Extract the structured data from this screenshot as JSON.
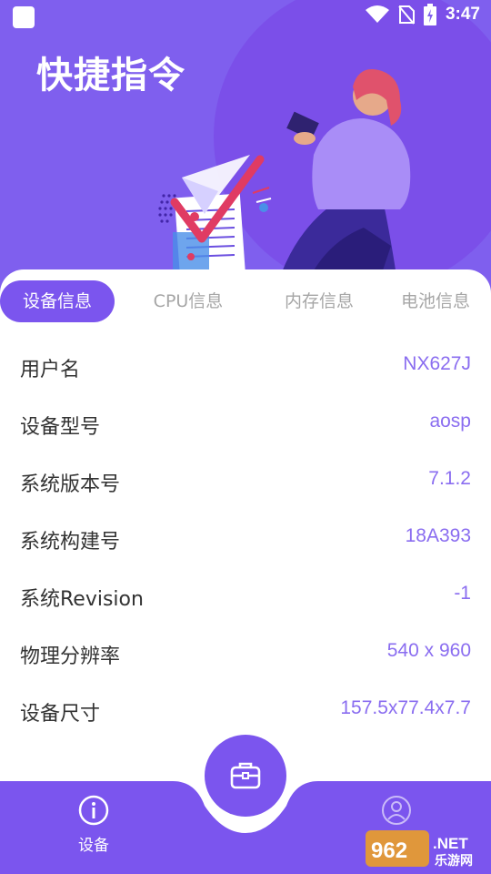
{
  "statusbar": {
    "time": "3:47",
    "icons": [
      "wifi-icon",
      "no-sim-icon",
      "battery-charging-icon"
    ]
  },
  "app": {
    "title": "快捷指令"
  },
  "tabs": [
    {
      "label": "设备信息",
      "active": true
    },
    {
      "label": "CPU信息",
      "active": false
    },
    {
      "label": "内存信息",
      "active": false
    },
    {
      "label": "电池信息",
      "active": false
    }
  ],
  "device_info": [
    {
      "label": "用户名",
      "value": "NX627J"
    },
    {
      "label": "设备型号",
      "value": "aosp"
    },
    {
      "label": "系统版本号",
      "value": "7.1.2"
    },
    {
      "label": "系统构建号",
      "value": "18A393"
    },
    {
      "label": "系统Revision",
      "value": "-1"
    },
    {
      "label": "物理分辨率",
      "value": "540 x 960"
    },
    {
      "label": "设备尺寸",
      "value": "157.5x77.4x7.7"
    }
  ],
  "bottom_nav": {
    "left": {
      "label": "设备",
      "icon": "info-circle-icon"
    },
    "center": {
      "icon": "toolbox-icon"
    },
    "right": {
      "icon": "user-icon"
    }
  },
  "watermark": {
    "logo": "962.NET",
    "text": "乐游网"
  },
  "colors": {
    "primary": "#7b55ee",
    "hero_bg": "#7f5fee",
    "value_text": "#8a6df0",
    "label_text": "#333333",
    "tab_inactive": "#a6a6a6"
  }
}
